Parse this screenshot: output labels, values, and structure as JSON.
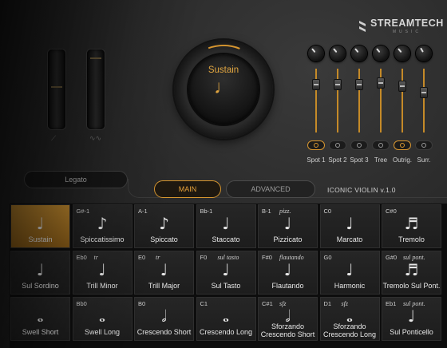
{
  "brand": {
    "name": "STREAMTECH",
    "sub": "MUSIC"
  },
  "knob": {
    "label": "Sustain",
    "note": "♩"
  },
  "mixer": [
    {
      "label": "Spot 1",
      "active": true,
      "level": 0.75
    },
    {
      "label": "Spot 2",
      "active": false,
      "level": 0.75
    },
    {
      "label": "Spot 3",
      "active": false,
      "level": 0.75
    },
    {
      "label": "Tree",
      "active": false,
      "level": 0.78
    },
    {
      "label": "Outrig.",
      "active": true,
      "level": 0.72
    },
    {
      "label": "Surr.",
      "active": false,
      "level": 0.62
    }
  ],
  "legato": "Legato",
  "tabs": {
    "main": "MAIN",
    "advanced": "ADVANCED"
  },
  "product": "ICONIC VIOLIN v.1.0",
  "articulations": [
    {
      "key": "",
      "hint": "",
      "glyph": "♩",
      "name": "Sustain",
      "selected": true
    },
    {
      "key": "G#-1",
      "hint": "",
      "glyph": "♪",
      "name": "Spiccatissimo"
    },
    {
      "key": "A-1",
      "hint": "",
      "glyph": "♪",
      "name": "Spiccato"
    },
    {
      "key": "Bb-1",
      "hint": "",
      "glyph": "♩",
      "name": "Staccato"
    },
    {
      "key": "B-1",
      "hint": "pizz.",
      "glyph": "♩",
      "name": "Pizzicato"
    },
    {
      "key": "C0",
      "hint": "",
      "glyph": "♩",
      "name": "Marcato"
    },
    {
      "key": "C#0",
      "hint": "",
      "glyph": "♬",
      "name": "Tremolo"
    },
    {
      "key": "",
      "hint": "",
      "glyph": "♩",
      "name": "Sul Sordino"
    },
    {
      "key": "Eb0",
      "hint": "tr",
      "glyph": "♩",
      "name": "Trill Minor"
    },
    {
      "key": "E0",
      "hint": "tr",
      "glyph": "♩",
      "name": "Trill Major"
    },
    {
      "key": "F0",
      "hint": "sul tasto",
      "glyph": "♩",
      "name": "Sul Tasto"
    },
    {
      "key": "F#0",
      "hint": "flautando",
      "glyph": "♩",
      "name": "Flautando"
    },
    {
      "key": "G0",
      "hint": "",
      "glyph": "♩",
      "name": "Harmonic"
    },
    {
      "key": "G#0",
      "hint": "sul pont.",
      "glyph": "♬",
      "name": "Tremolo Sul Pont."
    },
    {
      "key": "",
      "hint": "",
      "glyph": "𝅝",
      "name": "Swell Short"
    },
    {
      "key": "Bb0",
      "hint": "",
      "glyph": "𝅝",
      "name": "Swell Long"
    },
    {
      "key": "B0",
      "hint": "",
      "glyph": "𝅗𝅥",
      "name": "Crescendo Short"
    },
    {
      "key": "C1",
      "hint": "",
      "glyph": "𝅝",
      "name": "Crescendo Long"
    },
    {
      "key": "C#1",
      "hint": "sfz",
      "glyph": "𝅗𝅥",
      "name": "Sforzando Crescendo Short"
    },
    {
      "key": "D1",
      "hint": "sfz",
      "glyph": "𝅝",
      "name": "Sforzando Crescendo Long"
    },
    {
      "key": "Eb1",
      "hint": "sul pont.",
      "glyph": "♩",
      "name": "Sul Ponticello"
    }
  ],
  "colors": {
    "accent": "#d7962f",
    "bg": "#2a2a2a"
  }
}
